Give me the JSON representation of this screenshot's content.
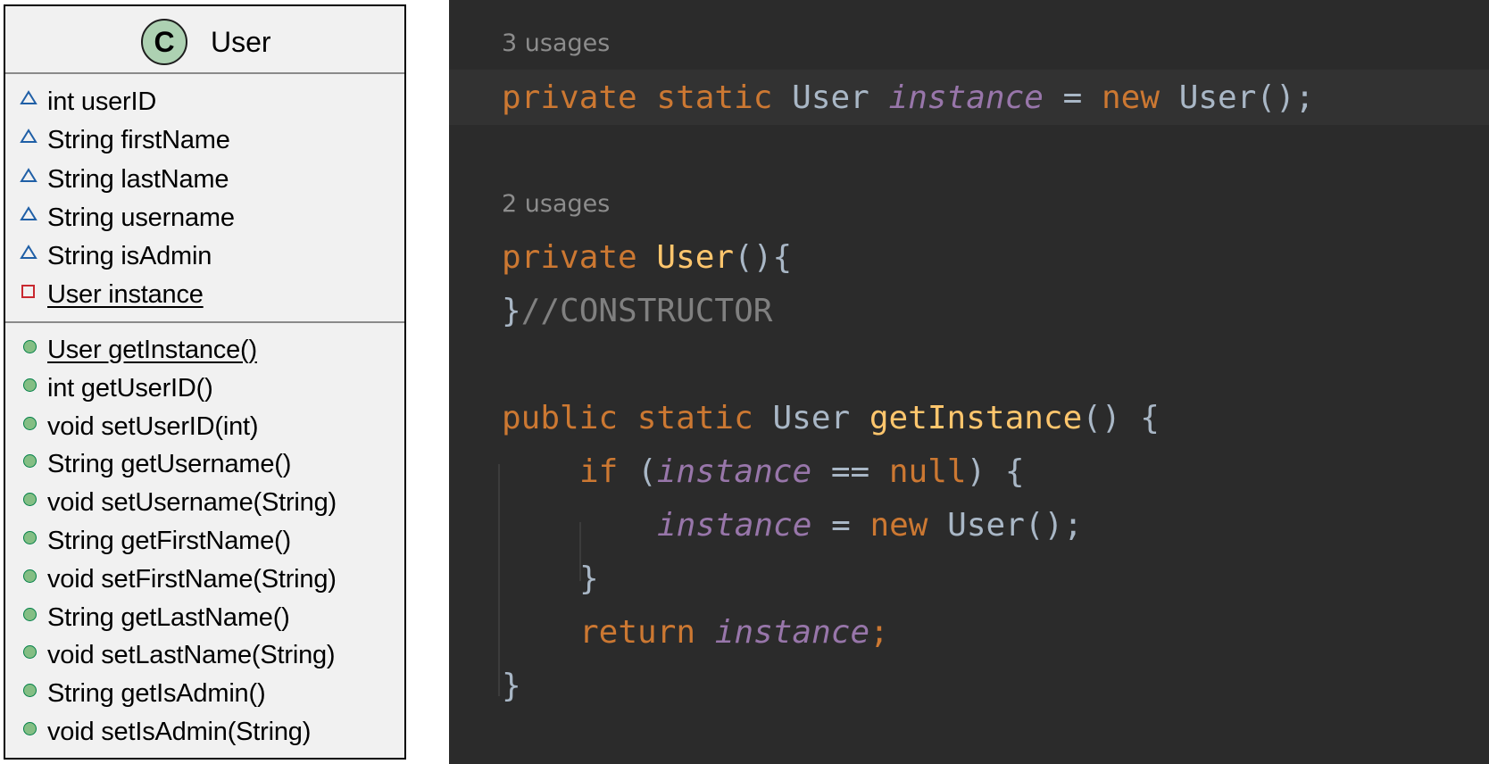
{
  "uml": {
    "badge_letter": "C",
    "class_name": "User",
    "fields": [
      {
        "text": "int userID",
        "visibility": "package",
        "underline": false
      },
      {
        "text": "String firstName",
        "visibility": "package",
        "underline": false
      },
      {
        "text": "String lastName",
        "visibility": "package",
        "underline": false
      },
      {
        "text": "String username",
        "visibility": "package",
        "underline": false
      },
      {
        "text": "String isAdmin",
        "visibility": "package",
        "underline": false
      },
      {
        "text": "User instance",
        "visibility": "private",
        "underline": true
      }
    ],
    "methods": [
      {
        "text": "User getInstance()",
        "visibility": "public",
        "underline": true
      },
      {
        "text": "int getUserID()",
        "visibility": "public",
        "underline": false
      },
      {
        "text": "void setUserID(int)",
        "visibility": "public",
        "underline": false
      },
      {
        "text": "String getUsername()",
        "visibility": "public",
        "underline": false
      },
      {
        "text": "void setUsername(String)",
        "visibility": "public",
        "underline": false
      },
      {
        "text": "String getFirstName()",
        "visibility": "public",
        "underline": false
      },
      {
        "text": "void setFirstName(String)",
        "visibility": "public",
        "underline": false
      },
      {
        "text": "String getLastName()",
        "visibility": "public",
        "underline": false
      },
      {
        "text": "void setLastName(String)",
        "visibility": "public",
        "underline": false
      },
      {
        "text": "String getIsAdmin()",
        "visibility": "public",
        "underline": false
      },
      {
        "text": "void setIsAdmin(String)",
        "visibility": "public",
        "underline": false
      }
    ],
    "colors": {
      "badge_fill": "#add1b2",
      "package_triangle": "#1f5fa6",
      "private_square": "#c82930",
      "public_dot": "#84be84"
    }
  },
  "editor": {
    "usage_hint_1": "3 usages",
    "usage_hint_2": "2 usages",
    "tokens": {
      "private": "private",
      "static": "static",
      "public": "public",
      "new": "new",
      "if": "if",
      "null": "null",
      "return": "return",
      "type_user": "User",
      "field_instance": "instance",
      "method_get_instance": "getInstance",
      "comment_constructor": "//CONSTRUCTOR",
      "assign": "=",
      "equals": "==",
      "call_parens_semi": "();",
      "semicolon": ";",
      "ctor_parens_brace": "(){",
      "open_paren": "(",
      "close_paren_brace": ") {",
      "empty_parens_brace": "() {",
      "close_brace": "}"
    },
    "colors": {
      "background": "#2b2b2b",
      "keyword": "#cc7832",
      "field": "#9876aa",
      "method": "#ffc66d",
      "plain": "#a9b7c6",
      "comment": "#808080"
    }
  }
}
